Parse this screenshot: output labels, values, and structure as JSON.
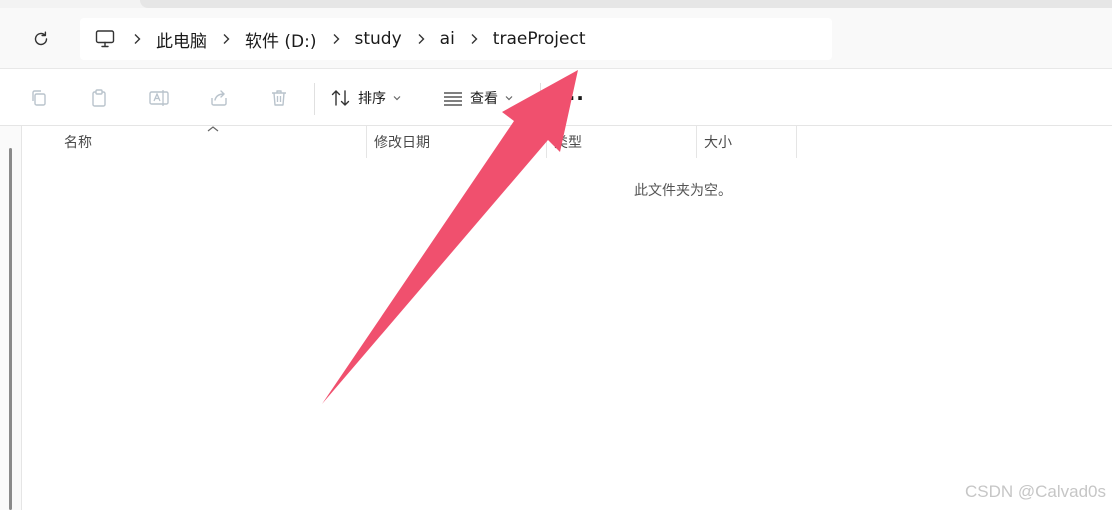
{
  "breadcrumb": {
    "items": [
      "此电脑",
      "软件 (D:)",
      "study",
      "ai",
      "traeProject"
    ]
  },
  "toolbar": {
    "sort_label": "排序",
    "view_label": "查看",
    "more_label": "···"
  },
  "columns": {
    "name": "名称",
    "modified": "修改日期",
    "type": "类型",
    "size": "大小"
  },
  "content": {
    "empty_message": "此文件夹为空。"
  },
  "watermark": "CSDN @Calvad0s",
  "colors": {
    "arrow": "#f0506e",
    "disabled_icon": "#b9c3cc",
    "icon_dark": "#333333"
  }
}
